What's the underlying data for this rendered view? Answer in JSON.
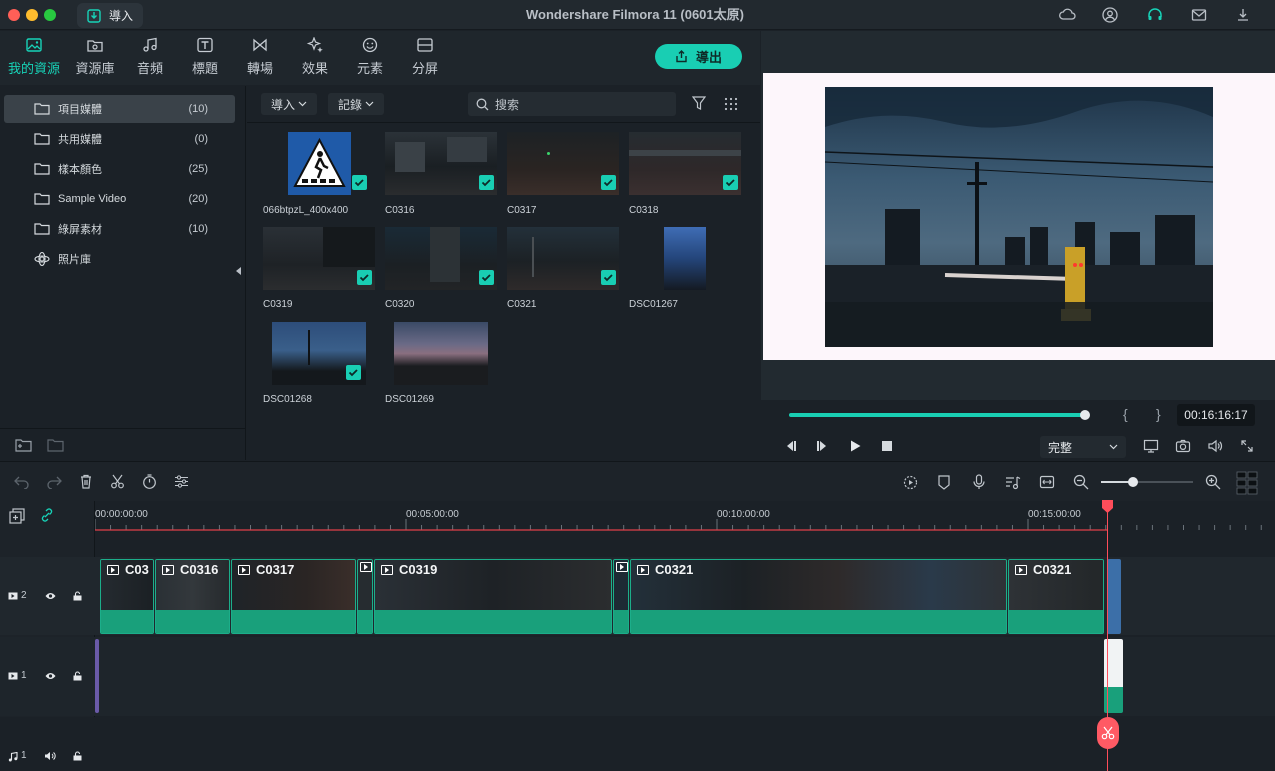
{
  "window": {
    "title": "Wondershare Filmora 11 (0601太原)",
    "import_button": "導入"
  },
  "tabs": [
    {
      "label": "我的資源",
      "icon": "image-icon",
      "active": true
    },
    {
      "label": "資源庫",
      "icon": "folder-cloud-icon"
    },
    {
      "label": "音頻",
      "icon": "music-note-icon"
    },
    {
      "label": "標題",
      "icon": "text-title-icon"
    },
    {
      "label": "轉場",
      "icon": "transition-icon"
    },
    {
      "label": "效果",
      "icon": "sparkle-effects-icon"
    },
    {
      "label": "元素",
      "icon": "smiley-elements-icon"
    },
    {
      "label": "分屏",
      "icon": "split-screen-icon"
    }
  ],
  "export_button": "導出",
  "sidebar": {
    "items": [
      {
        "label": "項目媒體",
        "count": "(10)",
        "selected": true
      },
      {
        "label": "共用媒體",
        "count": "(0)"
      },
      {
        "label": "樣本顏色",
        "count": "(25)"
      },
      {
        "label": "Sample Video",
        "count": "(20)"
      },
      {
        "label": "綠屏素材",
        "count": "(10)"
      },
      {
        "label": "照片庫",
        "count": ""
      }
    ]
  },
  "media": {
    "import_dropdown": "導入",
    "record_dropdown": "記錄",
    "search_placeholder": "搜索",
    "items": [
      {
        "label": "066btpzL_400x400",
        "checked": true
      },
      {
        "label": "C0316",
        "checked": true
      },
      {
        "label": "C0317",
        "checked": true
      },
      {
        "label": "C0318",
        "checked": true
      },
      {
        "label": "C0319",
        "checked": true
      },
      {
        "label": "C0320",
        "checked": true
      },
      {
        "label": "C0321",
        "checked": true
      },
      {
        "label": "DSC01267",
        "checked": false
      },
      {
        "label": "DSC01268",
        "checked": true
      },
      {
        "label": "DSC01269",
        "checked": false
      }
    ]
  },
  "preview": {
    "progress": 1.0,
    "timecode": "00:16:16:17",
    "quality": "完整",
    "mark_in": "{",
    "mark_out": "}"
  },
  "timeline": {
    "ruler_labels": [
      "00:00:00:00",
      "00:05:00:00",
      "00:10:00:00",
      "00:15:00:00"
    ],
    "tracks": [
      {
        "label": "2",
        "type": "video"
      },
      {
        "label": "1",
        "type": "video"
      },
      {
        "label": "1",
        "type": "audio"
      }
    ],
    "clips": [
      "C03",
      "C0316",
      "C0317",
      "",
      "C0319",
      "",
      "C0321",
      "C0321"
    ]
  },
  "colors": {
    "accent": "#19ceb3",
    "playhead": "#ff4d5a",
    "clip_green": "#19a07b"
  }
}
